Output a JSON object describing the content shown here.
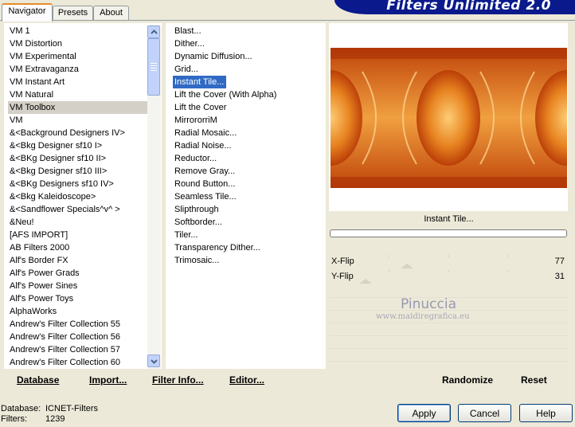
{
  "app_title": "Filters Unlimited 2.0",
  "tabs": [
    {
      "label": "Navigator"
    },
    {
      "label": "Presets"
    },
    {
      "label": "About"
    }
  ],
  "categories": [
    "VM 1",
    "VM Distortion",
    "VM Experimental",
    "VM Extravaganza",
    "VM Instant Art",
    "VM Natural",
    "VM Toolbox",
    "VM",
    "&<Background Designers IV>",
    "&<Bkg Designer sf10 I>",
    "&<BKg Designer sf10 II>",
    "&<Bkg Designer sf10 III>",
    "&<BKg Designers sf10 IV>",
    "&<Bkg Kaleidoscope>",
    "&<Sandflower Specials^v^ >",
    "&Neu!",
    "[AFS IMPORT]",
    "AB Filters 2000",
    "Alf's Border FX",
    "Alf's Power Grads",
    "Alf's Power Sines",
    "Alf's Power Toys",
    "AlphaWorks",
    "Andrew's Filter Collection 55",
    "Andrew's Filter Collection 56",
    "Andrew's Filter Collection 57",
    "Andrew's Filter Collection 60"
  ],
  "selected_category": "VM Toolbox",
  "filters": [
    "Blast...",
    "Dither...",
    "Dynamic Diffusion...",
    "Grid...",
    "Instant Tile...",
    "Lift the Cover (With Alpha)",
    "Lift the Cover",
    "MirrororriM",
    "Radial Mosaic...",
    "Radial Noise...",
    "Reductor...",
    "Remove Gray...",
    "Round Button...",
    "Seamless Tile...",
    "Slipthrough",
    "Softborder...",
    "Tiler...",
    "Transparency Dither...",
    "Trimosaic..."
  ],
  "selected_filter": "Instant Tile...",
  "left_buttons": {
    "database": "Database",
    "import": "Import...",
    "filter_info": "Filter Info...",
    "editor": "Editor..."
  },
  "preview": {
    "filter_name": "Instant Tile..."
  },
  "sliders": [
    {
      "label": "X-Flip",
      "value": "77",
      "fraction": 0.3
    },
    {
      "label": "Y-Flip",
      "value": "31",
      "fraction": 0.12
    }
  ],
  "right_buttons": {
    "randomize": "Randomize",
    "reset": "Reset"
  },
  "status": {
    "database_label": "Database:",
    "database_value": "ICNET-Filters",
    "filters_label": "Filters:",
    "filters_value": "1239"
  },
  "dialog_buttons": {
    "apply": "Apply",
    "cancel": "Cancel",
    "help": "Help"
  },
  "watermark": {
    "name": "Pinuccia",
    "site": "www.maidiregrafica.eu"
  },
  "colors": {
    "selection": "#316ac5",
    "banner": "#0a1a8c",
    "preview_orange": "#e06a10"
  }
}
